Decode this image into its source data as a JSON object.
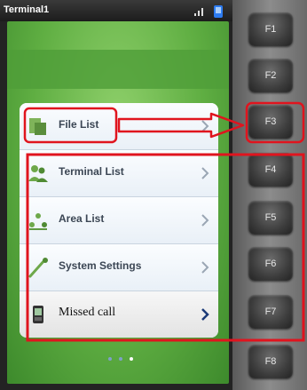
{
  "status_bar": {
    "title": "Terminal1"
  },
  "menu": {
    "items": [
      {
        "label": "File List",
        "icon": "file-icon"
      },
      {
        "label": "Terminal List",
        "icon": "users-icon"
      },
      {
        "label": "Area List",
        "icon": "area-icon"
      },
      {
        "label": "System Settings",
        "icon": "settings-icon"
      },
      {
        "label": "Missed call",
        "icon": "phone-icon"
      }
    ]
  },
  "keypad": {
    "keys": [
      "F1",
      "F2",
      "F3",
      "F4",
      "F5",
      "F6",
      "F7",
      "F8"
    ]
  },
  "annotation": {
    "color": "#e0141e"
  },
  "page_dots": {
    "count": 3,
    "active": 3
  }
}
